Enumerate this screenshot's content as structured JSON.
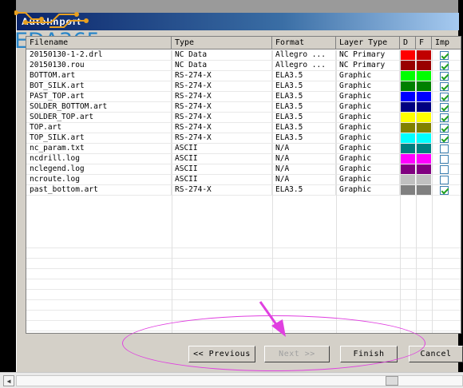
{
  "window": {
    "title": "AutoImport",
    "logo_text": "EDA365"
  },
  "table": {
    "headers": {
      "filename": "Filename",
      "type": "Type",
      "format": "Format",
      "layer_type": "Layer Type",
      "d": "D",
      "f": "F",
      "imp": "Imp"
    },
    "rows": [
      {
        "file": "20150130-1-2.drl",
        "type": "NC Data",
        "format": "Allegro ...",
        "layer": "NC Primary",
        "d": "#ff0000",
        "f": "#c00000",
        "imp": true
      },
      {
        "file": "20150130.rou",
        "type": "NC Data",
        "format": "Allegro ...",
        "layer": "NC Primary",
        "d": "#990000",
        "f": "#990000",
        "imp": true
      },
      {
        "file": "BOTTOM.art",
        "type": "RS-274-X",
        "format": "ELA3.5",
        "layer": "Graphic",
        "d": "#00ff00",
        "f": "#00ff00",
        "imp": true
      },
      {
        "file": "BOT_SILK.art",
        "type": "RS-274-X",
        "format": "ELA3.5",
        "layer": "Graphic",
        "d": "#008000",
        "f": "#008000",
        "imp": true
      },
      {
        "file": "PAST_TOP.art",
        "type": "RS-274-X",
        "format": "ELA3.5",
        "layer": "Graphic",
        "d": "#0000ff",
        "f": "#0000ff",
        "imp": true
      },
      {
        "file": "SOLDER_BOTTOM.art",
        "type": "RS-274-X",
        "format": "ELA3.5",
        "layer": "Graphic",
        "d": "#000080",
        "f": "#000080",
        "imp": true
      },
      {
        "file": "SOLDER_TOP.art",
        "type": "RS-274-X",
        "format": "ELA3.5",
        "layer": "Graphic",
        "d": "#ffff00",
        "f": "#ffff00",
        "imp": true
      },
      {
        "file": "TOP.art",
        "type": "RS-274-X",
        "format": "ELA3.5",
        "layer": "Graphic",
        "d": "#808000",
        "f": "#808000",
        "imp": true
      },
      {
        "file": "TOP_SILK.art",
        "type": "RS-274-X",
        "format": "ELA3.5",
        "layer": "Graphic",
        "d": "#00ffff",
        "f": "#00ffff",
        "imp": true
      },
      {
        "file": "nc_param.txt",
        "type": "ASCII",
        "format": "N/A",
        "layer": "Graphic",
        "d": "#008080",
        "f": "#008080",
        "imp": false
      },
      {
        "file": "ncdrill.log",
        "type": "ASCII",
        "format": "N/A",
        "layer": "Graphic",
        "d": "#ff00ff",
        "f": "#ff00ff",
        "imp": false
      },
      {
        "file": "nclegend.log",
        "type": "ASCII",
        "format": "N/A",
        "layer": "Graphic",
        "d": "#800080",
        "f": "#800080",
        "imp": false
      },
      {
        "file": "ncroute.log",
        "type": "ASCII",
        "format": "N/A",
        "layer": "Graphic",
        "d": "#c0c0c0",
        "f": "#c0c0c0",
        "imp": false
      },
      {
        "file": "past_bottom.art",
        "type": "RS-274-X",
        "format": "ELA3.5",
        "layer": "Graphic",
        "d": "#808080",
        "f": "#808080",
        "imp": true
      }
    ]
  },
  "buttons": {
    "previous": "<< Previous",
    "next": "Next >>",
    "finish": "Finish",
    "cancel": "Cancel"
  },
  "annotation": {
    "color": "#e040e0"
  }
}
